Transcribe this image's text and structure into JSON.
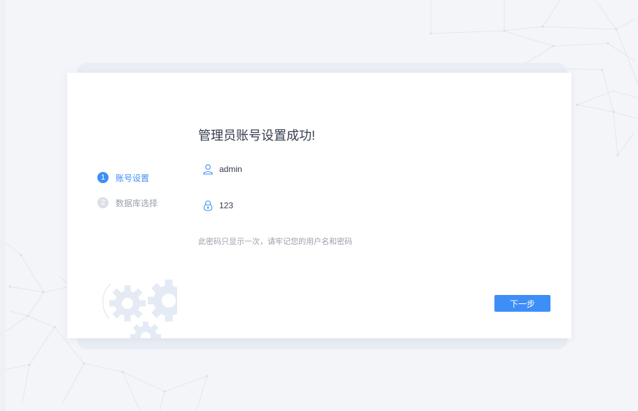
{
  "steps": [
    {
      "number": "1",
      "label": "账号设置",
      "state": "active"
    },
    {
      "number": "2",
      "label": "数据库选择",
      "state": "inactive"
    }
  ],
  "title": "管理员账号设置成功!",
  "account": {
    "username": "admin",
    "password": "123",
    "username_icon": "user-icon",
    "password_icon": "lock-icon"
  },
  "hint": "此密码只显示一次，请牢记您的用户名和密码",
  "next_button": {
    "label": "下一步"
  },
  "colors": {
    "accent": "#3e8ef7",
    "background": "#f3f5f9",
    "card": "#ffffff",
    "text": "#333c4d",
    "muted": "#9aa0aa"
  }
}
